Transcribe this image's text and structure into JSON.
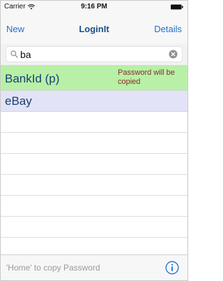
{
  "status_bar": {
    "carrier": "Carrier",
    "time": "9:16 PM"
  },
  "nav": {
    "left_button": "New",
    "title": "LoginIt",
    "right_button": "Details"
  },
  "search": {
    "value": "ba",
    "placeholder": ""
  },
  "entries": [
    {
      "title": "BankId (p)",
      "note": "Password will be copied",
      "highlight_color": "#b7f0a6"
    },
    {
      "title": "eBay",
      "note": "",
      "highlight_color": "#e3e3f7"
    }
  ],
  "toolbar": {
    "hint": "'Home' to copy Password"
  },
  "colors": {
    "accent": "#1f6fd0",
    "title": "#1b4f8a",
    "entry_text": "#1b3f73",
    "note_text": "#8a2c2c"
  }
}
